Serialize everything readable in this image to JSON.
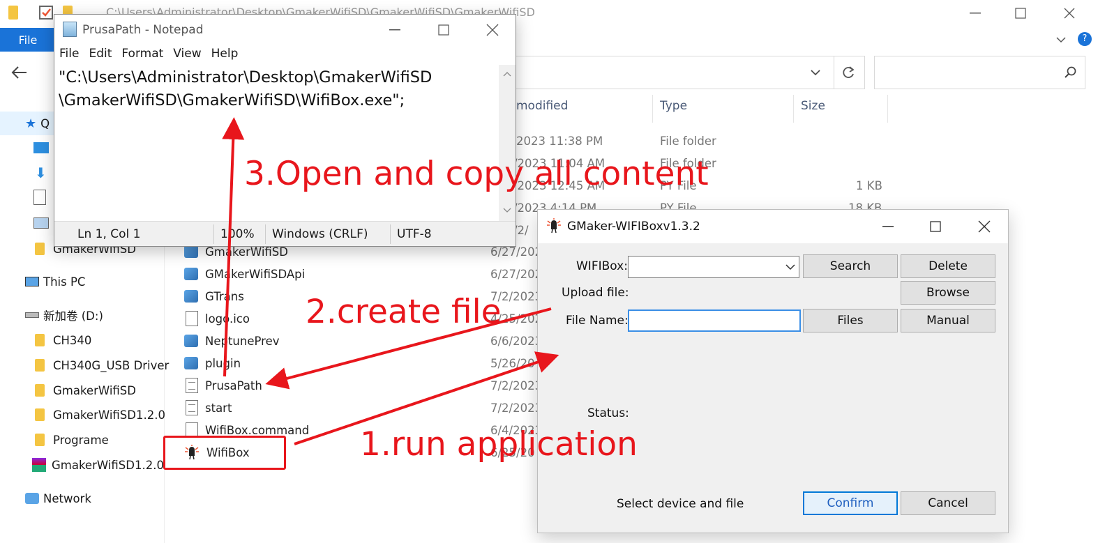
{
  "explorer": {
    "path_text": "C:\\Users\\Administrator\\Desktop\\GmakerWifiSD\\GmakerWifiSD\\GmakerWifiSD",
    "file_tab": "File",
    "columns": {
      "date": "modified",
      "type": "Type",
      "size": "Size"
    },
    "nav": [
      {
        "label": "Q"
      },
      {
        "label": "GmakerWifiSD"
      },
      {
        "label": "This PC"
      },
      {
        "label": "新加卷 (D:)"
      },
      {
        "label": "CH340"
      },
      {
        "label": "CH340G_USB Driver"
      },
      {
        "label": "GmakerWifiSD"
      },
      {
        "label": "GmakerWifiSD1.2.0"
      },
      {
        "label": "Programe"
      },
      {
        "label": "GmakerWifiSD1.2.0"
      },
      {
        "label": "Network"
      }
    ],
    "upper_rows": [
      {
        "date": "2023 11:38 PM",
        "type": "File folder",
        "size": ""
      },
      {
        "date": "/2023 11:04 AM",
        "type": "File folder",
        "size": ""
      },
      {
        "date": "/2023 12:45 AM",
        "type": "PY File",
        "size": "1 KB"
      },
      {
        "date": "/2023 4:14 PM",
        "type": "PY File",
        "size": "18 KB"
      },
      {
        "date": "/2/",
        "type": "",
        "size": ""
      }
    ],
    "files": [
      {
        "name": "GmakerWifiSD",
        "date": "6/27/202",
        "icon": "vs-project-icon"
      },
      {
        "name": "GMakerWifiSDApi",
        "date": "6/27/202",
        "icon": "vs-project-icon"
      },
      {
        "name": "GTrans",
        "date": "7/2/2023",
        "icon": "vs-project-icon"
      },
      {
        "name": "logo.ico",
        "date": "4/25/202",
        "icon": "blank-file-icon"
      },
      {
        "name": "NeptunePrev",
        "date": "6/6/2023",
        "icon": "vs-project-icon"
      },
      {
        "name": "plugin",
        "date": "5/26/20",
        "icon": "vs-project-icon"
      },
      {
        "name": "PrusaPath",
        "date": "7/2/2023",
        "icon": "text-file-icon"
      },
      {
        "name": "start",
        "date": "7/2/2023",
        "icon": "text-file-icon"
      },
      {
        "name": "WifiBox.command",
        "date": "6/4/2023",
        "icon": "blank-file-icon"
      },
      {
        "name": "WifiBox",
        "date": "6/25/20",
        "icon": "wifibox-app-icon"
      }
    ]
  },
  "notepad": {
    "title": "PrusaPath - Notepad",
    "menu": [
      "File",
      "Edit",
      "Format",
      "View",
      "Help"
    ],
    "content_line1": "\"C:\\Users\\Administrator\\Desktop\\GmakerWifiSD",
    "content_line2": "\\GmakerWifiSD\\GmakerWifiSD\\WifiBox.exe\";",
    "status": {
      "position": "Ln 1, Col 1",
      "zoom": "100%",
      "line_ending": "Windows (CRLF)",
      "encoding": "UTF-8"
    }
  },
  "wifibox": {
    "title": "GMaker-WIFIBoxv1.3.2",
    "labels": {
      "wifibox": "WIFIBox:",
      "upload": "Upload file:",
      "file_name": "File Name:",
      "status": "Status:"
    },
    "buttons": {
      "search": "Search",
      "delete": "Delete",
      "browse": "Browse",
      "files": "Files",
      "manual": "Manual",
      "confirm": "Confirm",
      "cancel": "Cancel"
    },
    "wifibox_value": "",
    "file_name_value": "",
    "status_message": "Select device and file"
  },
  "annotations": {
    "step1": "1.run application",
    "step2": "2.create file",
    "step3": "3.Open and copy all content",
    "color": "#e8161c"
  }
}
